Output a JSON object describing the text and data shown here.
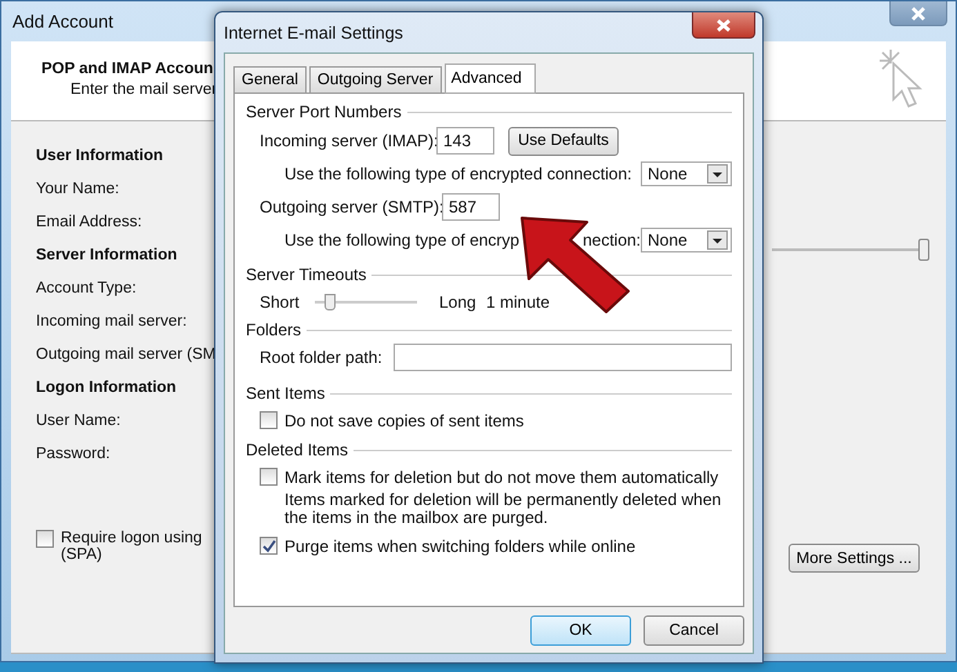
{
  "back_window": {
    "title": "Add Account",
    "heading": "POP and IMAP Accoun",
    "subheading": "Enter the mail server",
    "sections": [
      {
        "kind": "header",
        "text": "User Information"
      },
      {
        "kind": "label",
        "text": "Your Name:"
      },
      {
        "kind": "label",
        "text": "Email Address:"
      },
      {
        "kind": "header",
        "text": "Server Information"
      },
      {
        "kind": "label",
        "text": "Account Type:"
      },
      {
        "kind": "label",
        "text": "Incoming mail server:"
      },
      {
        "kind": "label",
        "text": "Outgoing mail server (SM"
      },
      {
        "kind": "header",
        "text": "Logon Information"
      },
      {
        "kind": "label",
        "text": "User Name:"
      },
      {
        "kind": "label",
        "text": "Password:"
      }
    ],
    "spa_checkbox": {
      "label": "Require logon using",
      "label_line2": "(SPA)",
      "checked": false
    },
    "slider": {
      "level": 1
    },
    "more_settings_button": "More Settings ..."
  },
  "dialog": {
    "title": "Internet E-mail Settings",
    "tabs": [
      {
        "label": "General",
        "selected": false
      },
      {
        "label": "Outgoing Server",
        "selected": false
      },
      {
        "label": "Advanced",
        "selected": true
      }
    ],
    "server_ports": {
      "heading": "Server Port Numbers",
      "incoming": {
        "label": "Incoming server (IMAP):",
        "value": "143"
      },
      "use_defaults_button": "Use Defaults",
      "incoming_encryption": {
        "label": "Use the following type of encrypted connection:",
        "value": "None"
      },
      "outgoing": {
        "label": "Outgoing server (SMTP):",
        "value": "587"
      },
      "outgoing_encryption": {
        "label": "Use the following type of encryp",
        "label_end": "nection:",
        "value": "None"
      }
    },
    "timeouts": {
      "heading": "Server Timeouts",
      "min_label": "Short",
      "max_label": "Long",
      "level": 0.1,
      "reading": "1 minute"
    },
    "folders": {
      "heading": "Folders",
      "root_label": "Root folder path:"
    },
    "sent_items": {
      "heading": "Sent Items",
      "checkbox": {
        "label": "Do not save copies of sent items",
        "checked": false
      }
    },
    "deleted_items": {
      "heading": "Deleted Items",
      "mark_checkbox": {
        "label": "Mark items for deletion but do not move them automatically",
        "checked": false
      },
      "note": "Items marked for deletion will be permanently deleted when the items in the mailbox are purged.",
      "purge_checkbox": {
        "label": "Purge items when switching folders while online",
        "checked": true
      }
    },
    "buttons": [
      "OK",
      "Cancel"
    ]
  }
}
